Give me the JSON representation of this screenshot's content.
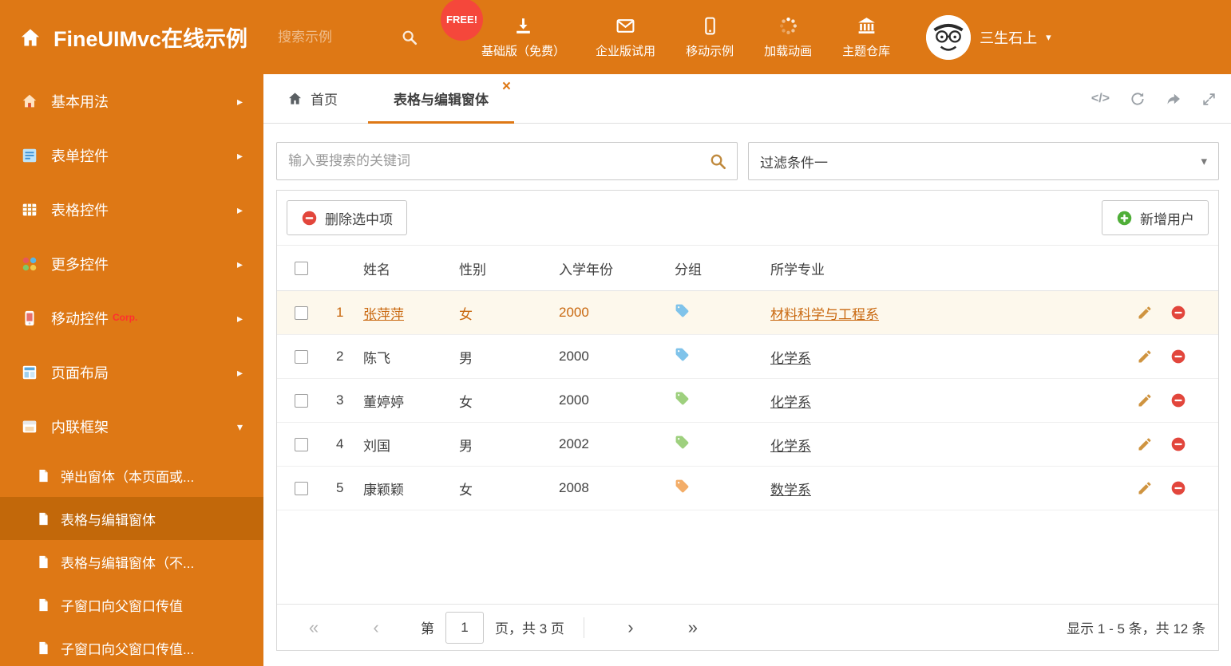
{
  "colors": {
    "theme": "#de7815",
    "theme_dark": "#c2680a",
    "selected_row_bg": "#fdf8ec",
    "selected_row_text": "#c9680f",
    "free_badge_bg": "#f5473b",
    "corp_badge": "#ff2f2f",
    "delete_red": "#e2463c",
    "add_green": "#4fae38",
    "edit_orange": "#cf9440"
  },
  "icons": {
    "first_page": "«",
    "prev_page": "‹",
    "next_page": "›",
    "last_page": "»",
    "caret_down": "▾",
    "arrow_right": "▸",
    "close": "×",
    "code": "</>"
  },
  "header": {
    "title": "FineUIMvc在线示例",
    "search_placeholder": "搜索示例",
    "free_badge": "FREE!",
    "nav": [
      {
        "label": "基础版（免费）"
      },
      {
        "label": "企业版试用"
      },
      {
        "label": "移动示例"
      },
      {
        "label": "加载动画"
      },
      {
        "label": "主题仓库"
      }
    ],
    "username": "三生石上"
  },
  "sidebar": {
    "items": [
      {
        "label": "基本用法"
      },
      {
        "label": "表单控件"
      },
      {
        "label": "表格控件"
      },
      {
        "label": "更多控件"
      },
      {
        "label": "移动控件",
        "badge": "Corp."
      },
      {
        "label": "页面布局"
      },
      {
        "label": "内联框架"
      }
    ],
    "subitems": [
      {
        "label": "弹出窗体（本页面或..."
      },
      {
        "label": "表格与编辑窗体"
      },
      {
        "label": "表格与编辑窗体（不..."
      },
      {
        "label": "子窗口向父窗口传值"
      },
      {
        "label": "子窗口向父窗口传值..."
      }
    ]
  },
  "tabs": {
    "home_label": "首页",
    "active_label": "表格与编辑窗体"
  },
  "filter": {
    "search_placeholder": "输入要搜索的关键词",
    "dropdown_value": "过滤条件一"
  },
  "toolbar": {
    "delete_label": "删除选中项",
    "add_label": "新增用户"
  },
  "table": {
    "columns": {
      "name": "姓名",
      "gender": "性别",
      "year": "入学年份",
      "group": "分组",
      "major": "所学专业"
    },
    "rows": [
      {
        "num": "1",
        "name": "张萍萍",
        "gender": "女",
        "year": "2000",
        "tag_color": "#7fc3ea",
        "major": "材料科学与工程系"
      },
      {
        "num": "2",
        "name": "陈飞",
        "gender": "男",
        "year": "2000",
        "tag_color": "#7fc3ea",
        "major": "化学系"
      },
      {
        "num": "3",
        "name": "董婷婷",
        "gender": "女",
        "year": "2000",
        "tag_color": "#9ed07e",
        "major": "化学系"
      },
      {
        "num": "4",
        "name": "刘国",
        "gender": "男",
        "year": "2002",
        "tag_color": "#9ed07e",
        "major": "化学系"
      },
      {
        "num": "5",
        "name": "康颖颖",
        "gender": "女",
        "year": "2008",
        "tag_color": "#f3ad68",
        "major": "数学系"
      }
    ]
  },
  "pagination": {
    "page_prefix": "第",
    "page_value": "1",
    "page_suffix": "页，共 3 页",
    "summary": "显示 1 - 5 条，共 12 条"
  }
}
